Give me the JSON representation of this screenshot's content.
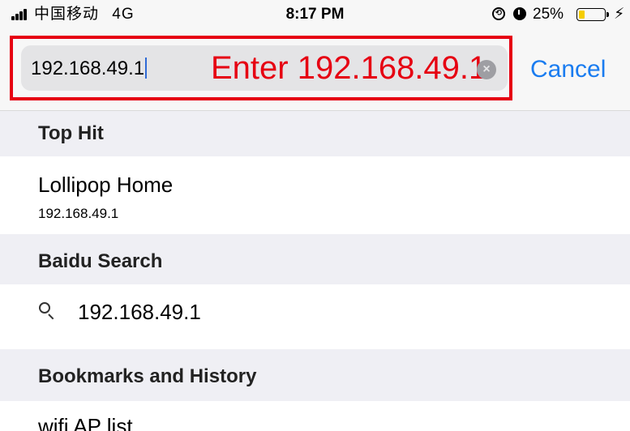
{
  "status_bar": {
    "carrier": "中国移动",
    "network": "4G",
    "time": "8:17 PM",
    "battery_percent": "25%",
    "battery_level": 0.25,
    "battery_color": "#f5cd00",
    "icons": [
      "signal-icon",
      "rotation-lock-icon",
      "alarm-icon",
      "battery-icon",
      "charging-icon"
    ]
  },
  "search": {
    "value": "192.168.49.1",
    "annotation": "Enter 192.168.49.1",
    "annotation_color": "#e60012",
    "cancel_label": "Cancel",
    "cancel_color": "#1a7cf0"
  },
  "sections": {
    "top_hit": {
      "header": "Top Hit",
      "item_title": "Lollipop Home",
      "item_subtitle": "192.168.49.1"
    },
    "baidu_search": {
      "header": "Baidu Search",
      "item_text": "192.168.49.1"
    },
    "bookmarks_history": {
      "header": "Bookmarks and History",
      "item_title": "wifi AP list"
    }
  }
}
